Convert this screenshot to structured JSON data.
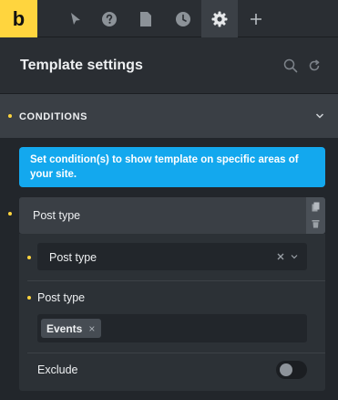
{
  "app": {
    "logo_text": "b",
    "accent_color": "#ffd53e",
    "info_color": "#13a8ee"
  },
  "toolbar": {
    "tools": [
      {
        "icon": "cursor-icon",
        "active": false
      },
      {
        "icon": "help-icon",
        "active": false
      },
      {
        "icon": "page-icon",
        "active": false
      },
      {
        "icon": "history-clock-icon",
        "active": false
      },
      {
        "icon": "gear-icon",
        "active": true
      },
      {
        "icon": "plus-icon",
        "active": false
      }
    ]
  },
  "header": {
    "title": "Template settings",
    "icons": [
      "search-icon",
      "reset-icon"
    ]
  },
  "section": {
    "title": "CONDITIONS",
    "icon": "chevron-down-icon"
  },
  "info": {
    "text": "Set condition(s) to show template on specific areas of your site."
  },
  "condition": {
    "title": "Post type",
    "actions": [
      "clone-icon",
      "delete-icon"
    ],
    "type_select": {
      "value": "Post type",
      "clear_icon": "close-icon",
      "dropdown_icon": "chevron-down-icon"
    },
    "post_type_field": {
      "label": "Post type",
      "tags": [
        {
          "label": "Events",
          "remove": "×"
        }
      ]
    },
    "exclude": {
      "label": "Exclude",
      "enabled": false
    }
  }
}
